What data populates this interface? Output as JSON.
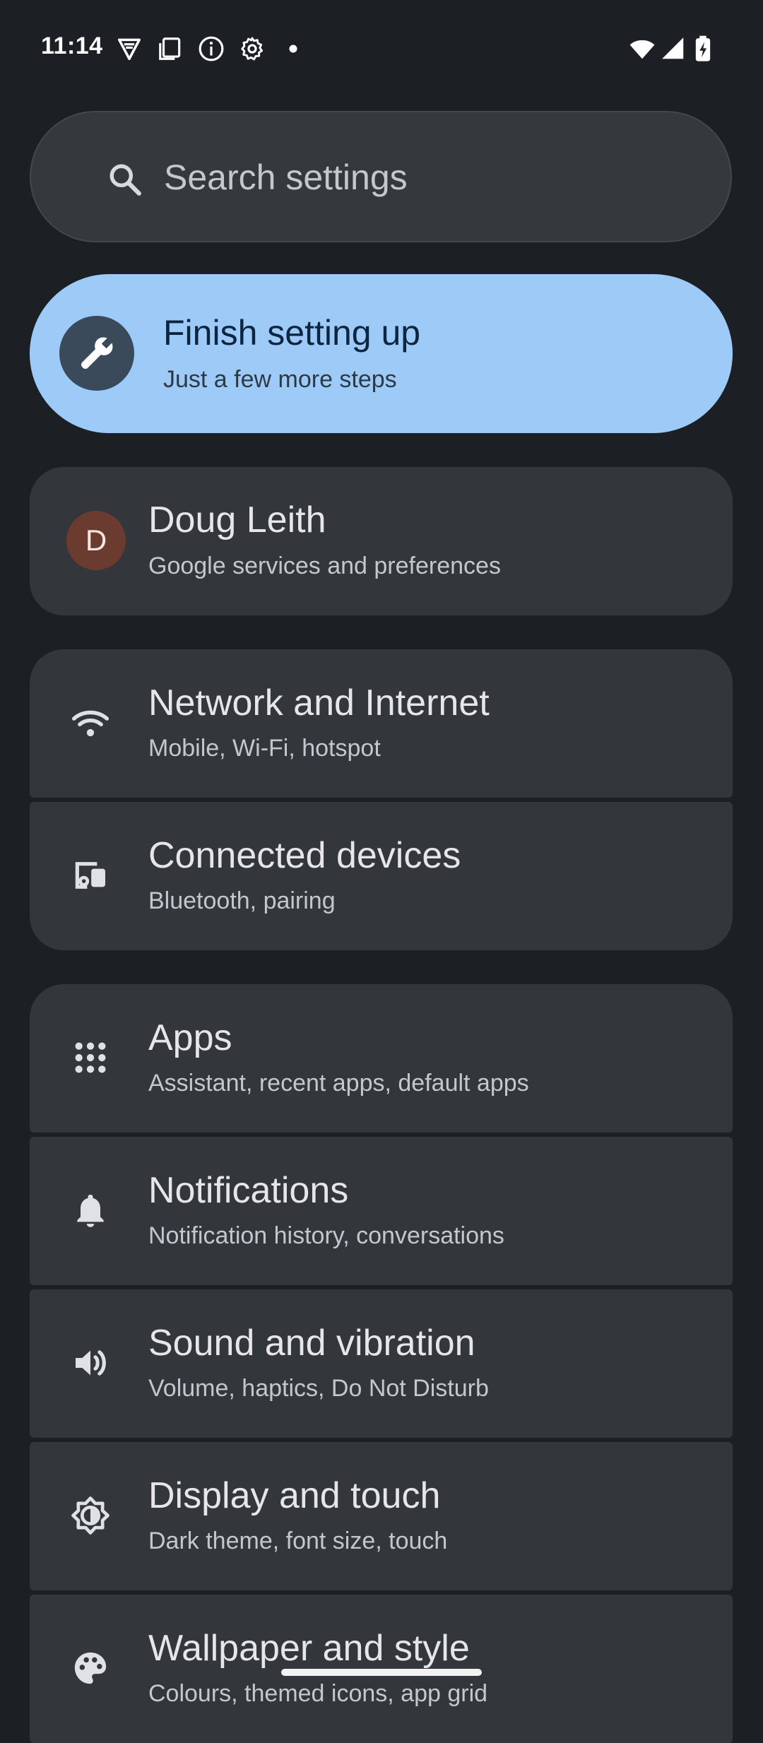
{
  "status_bar": {
    "time": "11:14",
    "left_icons": [
      "vpn-shield-icon",
      "screenshot-icon",
      "info-icon",
      "settings-gear-icon",
      "dot-icon"
    ],
    "right_icons": [
      "wifi-icon",
      "cell-signal-icon",
      "battery-charging-icon"
    ]
  },
  "search": {
    "placeholder": "Search settings",
    "icon": "search-icon"
  },
  "setup_card": {
    "title": "Finish setting up",
    "subtitle": "Just a few more steps",
    "icon": "wrench-icon"
  },
  "account": {
    "avatar_letter": "D",
    "name": "Doug Leith",
    "subtitle": "Google services and preferences"
  },
  "groups": [
    {
      "items": [
        {
          "icon": "wifi-icon",
          "title": "Network and Internet",
          "subtitle": "Mobile, Wi-Fi, hotspot"
        },
        {
          "icon": "connected-devices-icon",
          "title": "Connected devices",
          "subtitle": "Bluetooth, pairing"
        }
      ]
    },
    {
      "items": [
        {
          "icon": "apps-grid-icon",
          "title": "Apps",
          "subtitle": "Assistant, recent apps, default apps"
        },
        {
          "icon": "bell-icon",
          "title": "Notifications",
          "subtitle": "Notification history, conversations"
        },
        {
          "icon": "speaker-icon",
          "title": "Sound and vibration",
          "subtitle": "Volume, haptics, Do Not Disturb"
        },
        {
          "icon": "brightness-icon",
          "title": "Display and touch",
          "subtitle": "Dark theme, font size, touch"
        },
        {
          "icon": "palette-icon",
          "title": "Wallpaper and style",
          "subtitle": "Colours, themed icons, app grid"
        }
      ]
    }
  ],
  "colors": {
    "background": "#1c1f24",
    "card": "#33363b",
    "accent_card": "#9ecaf8",
    "avatar": "#6b3b2f"
  }
}
